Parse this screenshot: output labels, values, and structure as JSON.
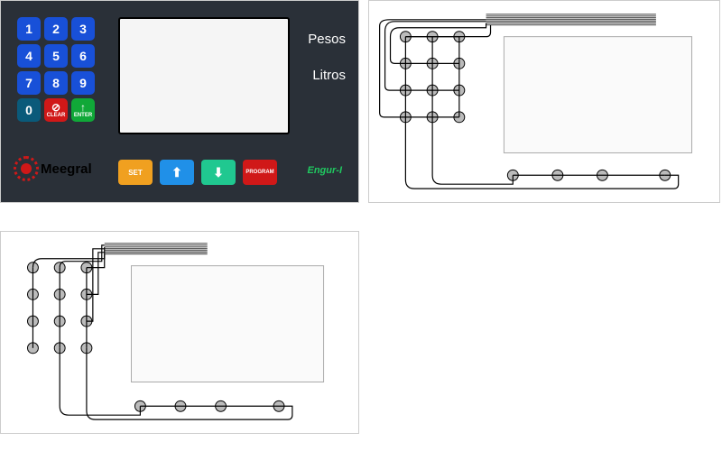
{
  "keypad": {
    "keys": [
      "1",
      "2",
      "3",
      "4",
      "5",
      "6",
      "7",
      "8",
      "9",
      "0"
    ],
    "clear_label": "CLEAR",
    "enter_label": "ENTER"
  },
  "display": {
    "label_top": "Pesos",
    "label_bottom": "Litros"
  },
  "logo": {
    "text": "Meegral"
  },
  "function_row": {
    "set": "SET",
    "program": "PROGRAM"
  },
  "brand_model": "Engur-I"
}
